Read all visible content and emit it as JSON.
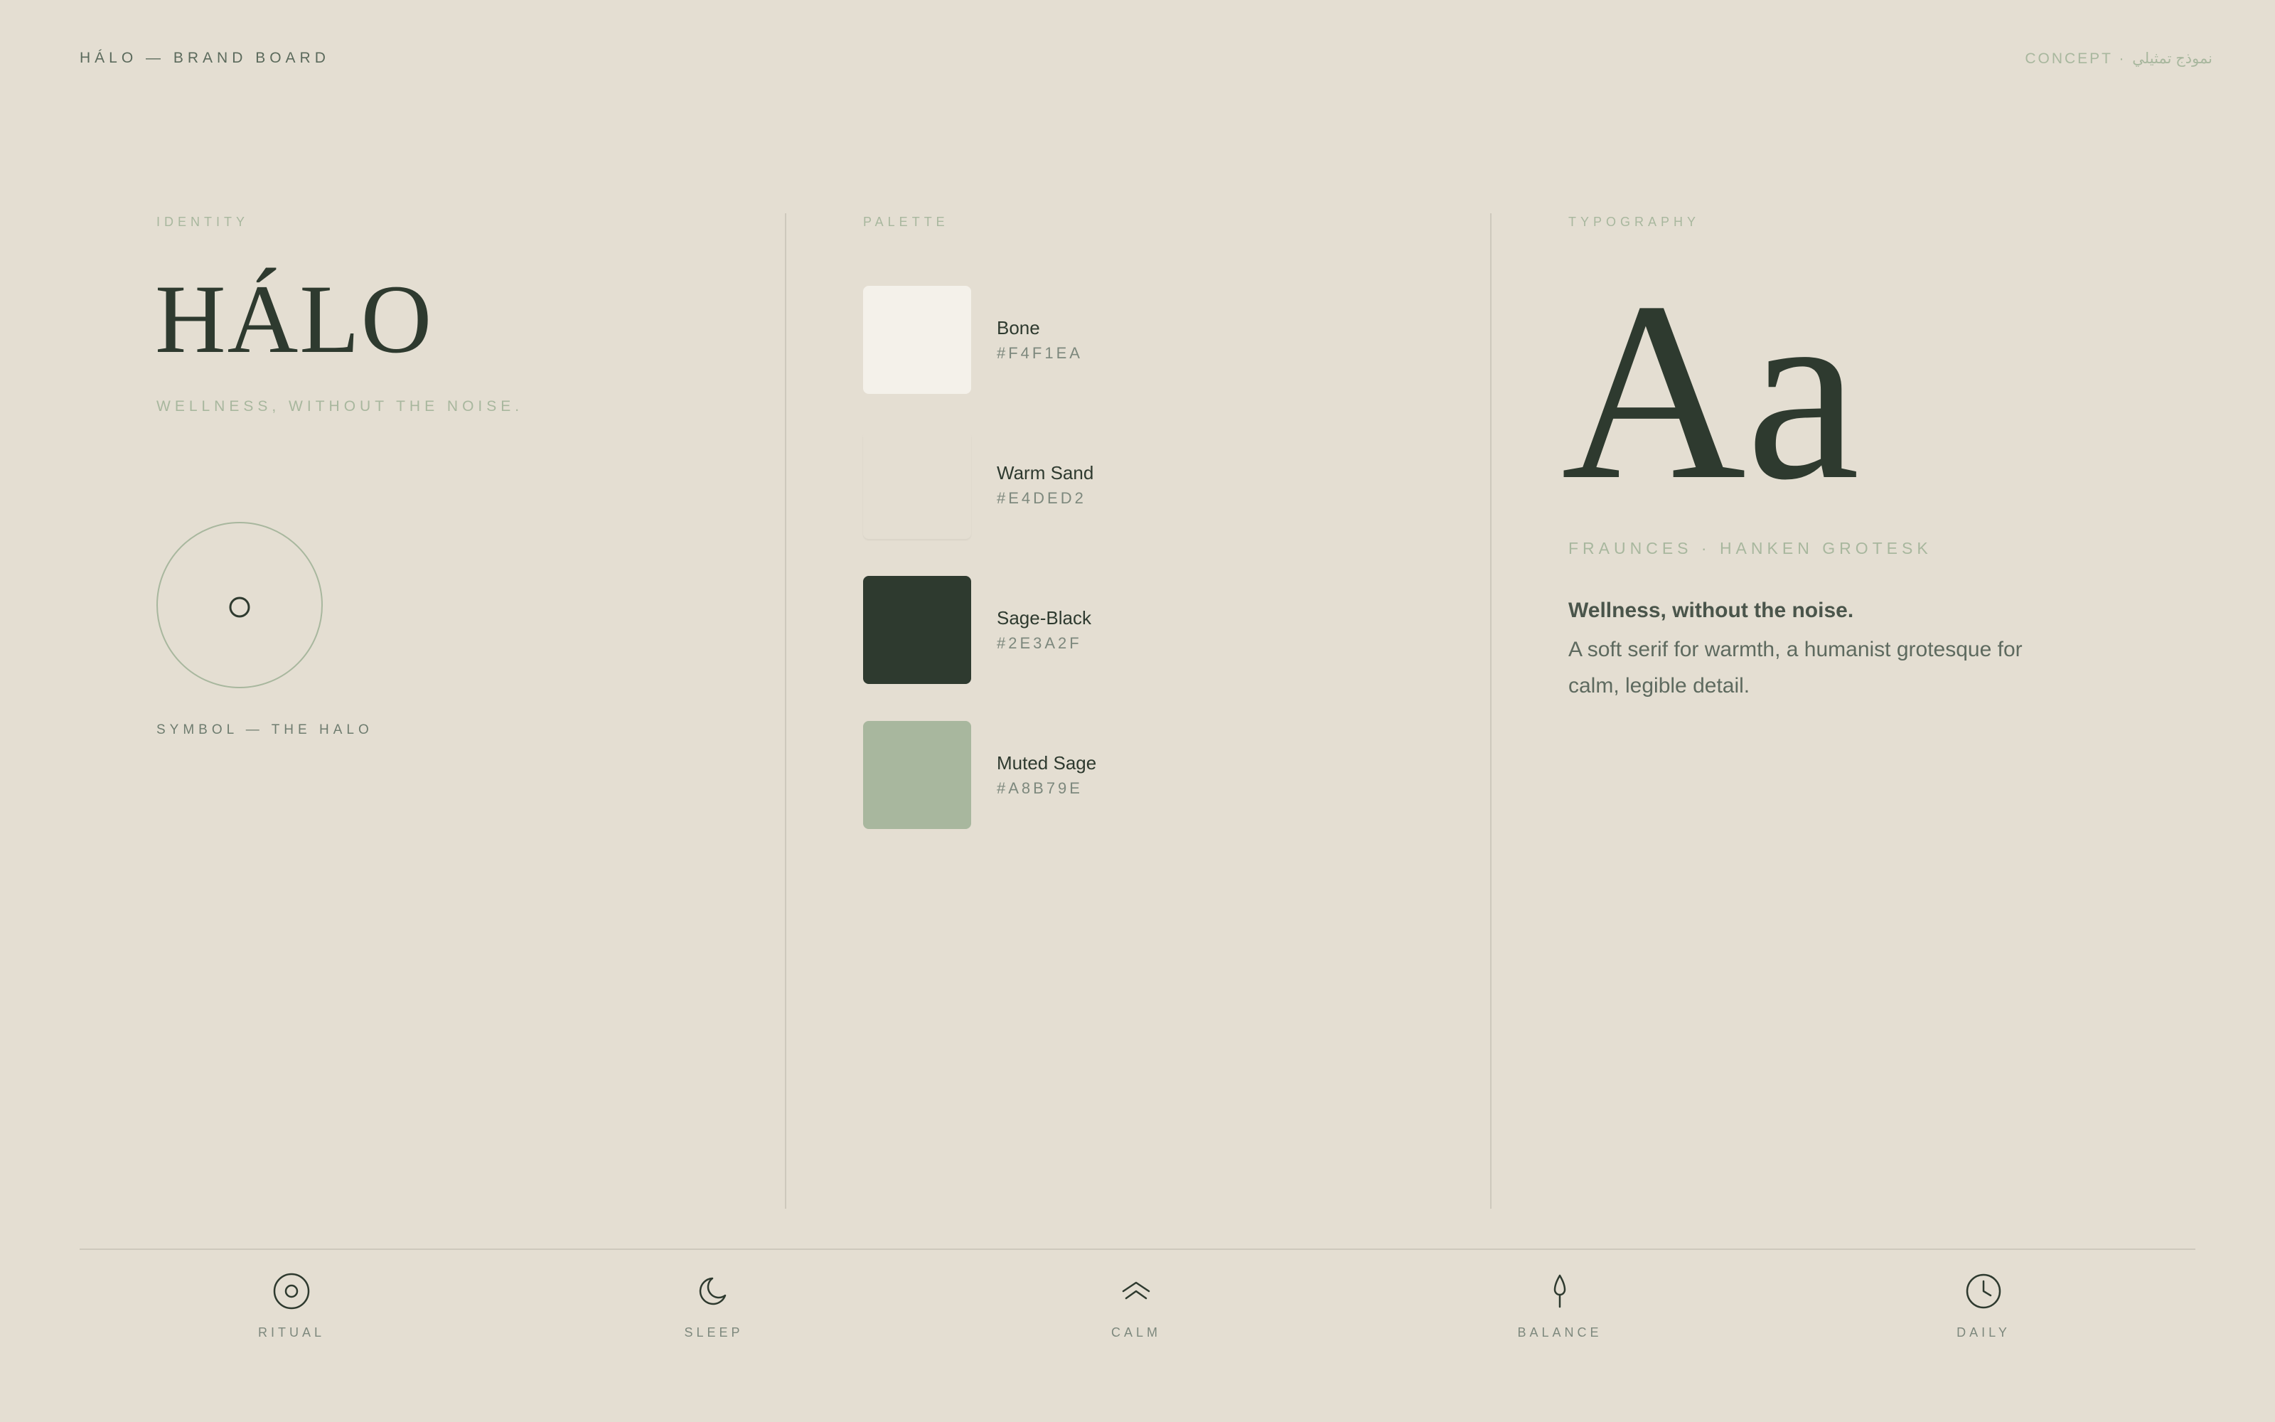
{
  "header": {
    "brand_line": "HÁLO — BRAND BOARD",
    "concept": "CONCEPT · نموذج تمثيلي"
  },
  "identity": {
    "label": "IDENTITY",
    "wordmark": "HÁLO",
    "tagline": "WELLNESS, WITHOUT THE NOISE.",
    "symbol_label": "SYMBOL — THE HALO"
  },
  "palette": {
    "label": "PALETTE",
    "colors": [
      {
        "name": "Bone",
        "hex": "#F4F1EA"
      },
      {
        "name": "Warm Sand",
        "hex": "#E4DED2"
      },
      {
        "name": "Sage-Black",
        "hex": "#2E3A2F"
      },
      {
        "name": "Muted Sage",
        "hex": "#A8B79E"
      }
    ]
  },
  "typography": {
    "label": "TYPOGRAPHY",
    "specimen": "Aa",
    "font_names": "FRAUNCES · HANKEN GROTESK",
    "sample_heading": "Wellness, without the noise.",
    "sample_body": "A soft serif for warmth, a humanist grotesque for calm, legible detail."
  },
  "footer": {
    "items": [
      {
        "label": "RITUAL",
        "icon": "ritual-circle-icon"
      },
      {
        "label": "SLEEP",
        "icon": "moon-icon"
      },
      {
        "label": "CALM",
        "icon": "double-chevron-up-icon"
      },
      {
        "label": "BALANCE",
        "icon": "droplet-icon"
      },
      {
        "label": "DAILY",
        "icon": "clock-icon"
      }
    ]
  }
}
